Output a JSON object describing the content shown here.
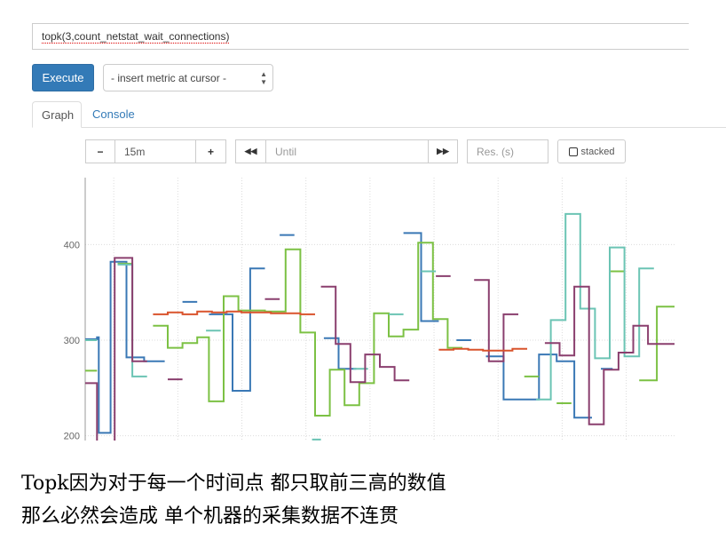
{
  "query": {
    "expression": "topk(3,count_netstat_wait_connections)"
  },
  "toolbar": {
    "execute_label": "Execute",
    "metric_select_value": "- insert metric at cursor -"
  },
  "tabs": [
    {
      "label": "Graph",
      "active": true
    },
    {
      "label": "Console",
      "active": false
    }
  ],
  "graph_controls": {
    "minus": "−",
    "range": "15m",
    "plus": "+",
    "back": "◀◀",
    "until_placeholder": "Until",
    "forward": "▶▶",
    "res_placeholder": "Res. (s)",
    "stacked_label": "stacked"
  },
  "caption": {
    "line1": "Topk因为对于每一个时间点 都只取前三高的数值",
    "line2": "那么必然会造成 单个机器的采集数据不连贯"
  },
  "chart_data": {
    "type": "line",
    "yticks": [
      200,
      300,
      400
    ],
    "ylim": [
      195,
      470
    ],
    "xlim": [
      0,
      100
    ],
    "series": [
      {
        "color": "#3a78b5",
        "points": [
          [
            0,
            301
          ],
          [
            2,
            301
          ],
          [
            2,
            303
          ],
          [
            2.3,
            303
          ],
          [
            2.3,
            203
          ],
          [
            4.3,
            203
          ],
          [
            4.3,
            382
          ],
          [
            7,
            382
          ],
          [
            7,
            282
          ],
          [
            10,
            282
          ],
          [
            10,
            278
          ],
          [
            12,
            278
          ],
          [
            12,
            278
          ],
          [
            13.5,
            278
          ],
          [
            null,
            null
          ],
          [
            16.5,
            340
          ],
          [
            19,
            340
          ],
          [
            null,
            null
          ],
          [
            21,
            327
          ],
          [
            25,
            327
          ],
          [
            25,
            247
          ],
          [
            28,
            247
          ],
          [
            28,
            375
          ],
          [
            30.5,
            375
          ],
          [
            null,
            null
          ],
          [
            33,
            410
          ],
          [
            35.5,
            410
          ],
          [
            null,
            null
          ],
          [
            40.5,
            302
          ],
          [
            43,
            302
          ],
          [
            43,
            270
          ],
          [
            46,
            270
          ],
          [
            null,
            null
          ],
          [
            54,
            412
          ],
          [
            57,
            412
          ],
          [
            57,
            320
          ],
          [
            60,
            320
          ],
          [
            null,
            null
          ],
          [
            63,
            300
          ],
          [
            65.5,
            300
          ],
          [
            null,
            null
          ],
          [
            68,
            283
          ],
          [
            71,
            283
          ],
          [
            71,
            238
          ],
          [
            74,
            238
          ],
          [
            74,
            238
          ],
          [
            77,
            238
          ],
          [
            77,
            285
          ],
          [
            80,
            285
          ],
          [
            80,
            278
          ],
          [
            83,
            278
          ],
          [
            83,
            219
          ],
          [
            86,
            219
          ],
          [
            null,
            null
          ],
          [
            87.5,
            270
          ],
          [
            89.5,
            270
          ]
        ]
      },
      {
        "color": "#7cc144",
        "points": [
          [
            0,
            268
          ],
          [
            2,
            268
          ],
          [
            null,
            null
          ],
          [
            5.5,
            380
          ],
          [
            8,
            380
          ],
          [
            8,
            380
          ],
          [
            null,
            null
          ],
          [
            11.5,
            315
          ],
          [
            14,
            315
          ],
          [
            14,
            292
          ],
          [
            16.5,
            292
          ],
          [
            16.5,
            297
          ],
          [
            19,
            297
          ],
          [
            19,
            303
          ],
          [
            21,
            303
          ],
          [
            21,
            236
          ],
          [
            23.5,
            236
          ],
          [
            23.5,
            346
          ],
          [
            26,
            346
          ],
          [
            26,
            331
          ],
          [
            28.5,
            331
          ],
          [
            28.5,
            331
          ],
          [
            30.5,
            331
          ],
          [
            30.5,
            330
          ],
          [
            34,
            330
          ],
          [
            34,
            395
          ],
          [
            36.5,
            395
          ],
          [
            36.5,
            308
          ],
          [
            39,
            308
          ],
          [
            39,
            221
          ],
          [
            41.5,
            221
          ],
          [
            41.5,
            269
          ],
          [
            44,
            269
          ],
          [
            44,
            232
          ],
          [
            46.5,
            232
          ],
          [
            46.5,
            255
          ],
          [
            49,
            255
          ],
          [
            49,
            328
          ],
          [
            51.5,
            328
          ],
          [
            51.5,
            304
          ],
          [
            54,
            304
          ],
          [
            54,
            311
          ],
          [
            56.5,
            311
          ],
          [
            56.5,
            402
          ],
          [
            59,
            402
          ],
          [
            59,
            322
          ],
          [
            61.5,
            322
          ],
          [
            61.5,
            292
          ],
          [
            64,
            292
          ],
          [
            null,
            null
          ],
          [
            74.5,
            262
          ],
          [
            77,
            262
          ],
          [
            null,
            null
          ],
          [
            80,
            234
          ],
          [
            82.5,
            234
          ],
          [
            null,
            null
          ],
          [
            89,
            372
          ],
          [
            91.5,
            372
          ],
          [
            null,
            null
          ],
          [
            94,
            258
          ],
          [
            97,
            258
          ],
          [
            97,
            335
          ],
          [
            100,
            335
          ]
        ]
      },
      {
        "color": "#6bc4b4",
        "points": [
          [
            0,
            300
          ],
          [
            2,
            300
          ],
          [
            null,
            null
          ],
          [
            5.5,
            379
          ],
          [
            8,
            379
          ],
          [
            8,
            262
          ],
          [
            10.5,
            262
          ],
          [
            null,
            null
          ],
          [
            20.5,
            310
          ],
          [
            23,
            310
          ],
          [
            null,
            null
          ],
          [
            38.5,
            196
          ],
          [
            40,
            196
          ],
          [
            null,
            null
          ],
          [
            45.5,
            270
          ],
          [
            48,
            270
          ],
          [
            null,
            null
          ],
          [
            51.5,
            327
          ],
          [
            54,
            327
          ],
          [
            null,
            null
          ],
          [
            57,
            372
          ],
          [
            59.5,
            372
          ],
          [
            null,
            null
          ],
          [
            76.5,
            238
          ],
          [
            79,
            238
          ],
          [
            79,
            321
          ],
          [
            81.5,
            321
          ],
          [
            81.5,
            432
          ],
          [
            84,
            432
          ],
          [
            84,
            333
          ],
          [
            86.5,
            333
          ],
          [
            86.5,
            281
          ],
          [
            89,
            281
          ],
          [
            89,
            397
          ],
          [
            91.5,
            397
          ],
          [
            91.5,
            283
          ],
          [
            94,
            283
          ],
          [
            94,
            375
          ],
          [
            96.5,
            375
          ]
        ]
      },
      {
        "color": "#8a3f6e",
        "points": [
          [
            0,
            255
          ],
          [
            2,
            255
          ],
          [
            2,
            190
          ],
          [
            5,
            190
          ],
          [
            5,
            386
          ],
          [
            8,
            386
          ],
          [
            8,
            278
          ],
          [
            10.5,
            278
          ],
          [
            null,
            null
          ],
          [
            14,
            259
          ],
          [
            16.5,
            259
          ],
          [
            null,
            null
          ],
          [
            30.5,
            343
          ],
          [
            33,
            343
          ],
          [
            null,
            null
          ],
          [
            40,
            356
          ],
          [
            42.5,
            356
          ],
          [
            42.5,
            296
          ],
          [
            45,
            296
          ],
          [
            45,
            256
          ],
          [
            47.5,
            256
          ],
          [
            47.5,
            285
          ],
          [
            50,
            285
          ],
          [
            50,
            272
          ],
          [
            52.5,
            272
          ],
          [
            52.5,
            258
          ],
          [
            55,
            258
          ],
          [
            null,
            null
          ],
          [
            59.5,
            367
          ],
          [
            62,
            367
          ],
          [
            null,
            null
          ],
          [
            66,
            363
          ],
          [
            68.5,
            363
          ],
          [
            68.5,
            278
          ],
          [
            71,
            278
          ],
          [
            71,
            327
          ],
          [
            73.5,
            327
          ],
          [
            null,
            null
          ],
          [
            78,
            297
          ],
          [
            80.5,
            297
          ],
          [
            80.5,
            284
          ],
          [
            83,
            284
          ],
          [
            83,
            356
          ],
          [
            85.5,
            356
          ],
          [
            85.5,
            212
          ],
          [
            88,
            212
          ],
          [
            88,
            269
          ],
          [
            90.5,
            269
          ],
          [
            90.5,
            287
          ],
          [
            93,
            287
          ],
          [
            93,
            315
          ],
          [
            95.5,
            315
          ],
          [
            95.5,
            296
          ],
          [
            98,
            296
          ],
          [
            98,
            296
          ],
          [
            100,
            296
          ]
        ]
      },
      {
        "color": "#d9532c",
        "points": [
          [
            11.5,
            327
          ],
          [
            14,
            327
          ],
          [
            14,
            329
          ],
          [
            16.5,
            329
          ],
          [
            16.5,
            327
          ],
          [
            19,
            327
          ],
          [
            19,
            330
          ],
          [
            21.5,
            330
          ],
          [
            21.5,
            329
          ],
          [
            24,
            329
          ],
          [
            24,
            330
          ],
          [
            26.5,
            330
          ],
          [
            26.5,
            329
          ],
          [
            29,
            329
          ],
          [
            29,
            329
          ],
          [
            31.5,
            329
          ],
          [
            31.5,
            328
          ],
          [
            34,
            328
          ],
          [
            34,
            328
          ],
          [
            36.5,
            328
          ],
          [
            36.5,
            327
          ],
          [
            39,
            327
          ],
          [
            null,
            null
          ],
          [
            60,
            290
          ],
          [
            62.5,
            290
          ],
          [
            62.5,
            291
          ],
          [
            65,
            291
          ],
          [
            65,
            290
          ],
          [
            67.5,
            290
          ],
          [
            67.5,
            289
          ],
          [
            70,
            289
          ],
          [
            70,
            289
          ],
          [
            72.5,
            289
          ],
          [
            72.5,
            291
          ],
          [
            75,
            291
          ]
        ]
      }
    ]
  }
}
